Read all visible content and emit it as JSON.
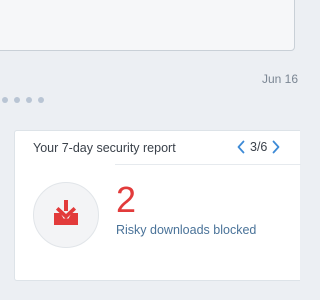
{
  "message": {
    "date": "Jun 16"
  },
  "report_card": {
    "title": "Your 7-day security report",
    "pager": "3/6",
    "stat_value": "2",
    "stat_label": "Risky downloads blocked"
  },
  "colors": {
    "accent_red": "#e23b3b",
    "link_blue": "#3d8ad6",
    "label_blue": "#4a7399"
  },
  "icons": {
    "previous": "chevron-left-icon",
    "next": "chevron-right-icon",
    "report": "download-tray-icon",
    "typing": "typing-indicator"
  }
}
